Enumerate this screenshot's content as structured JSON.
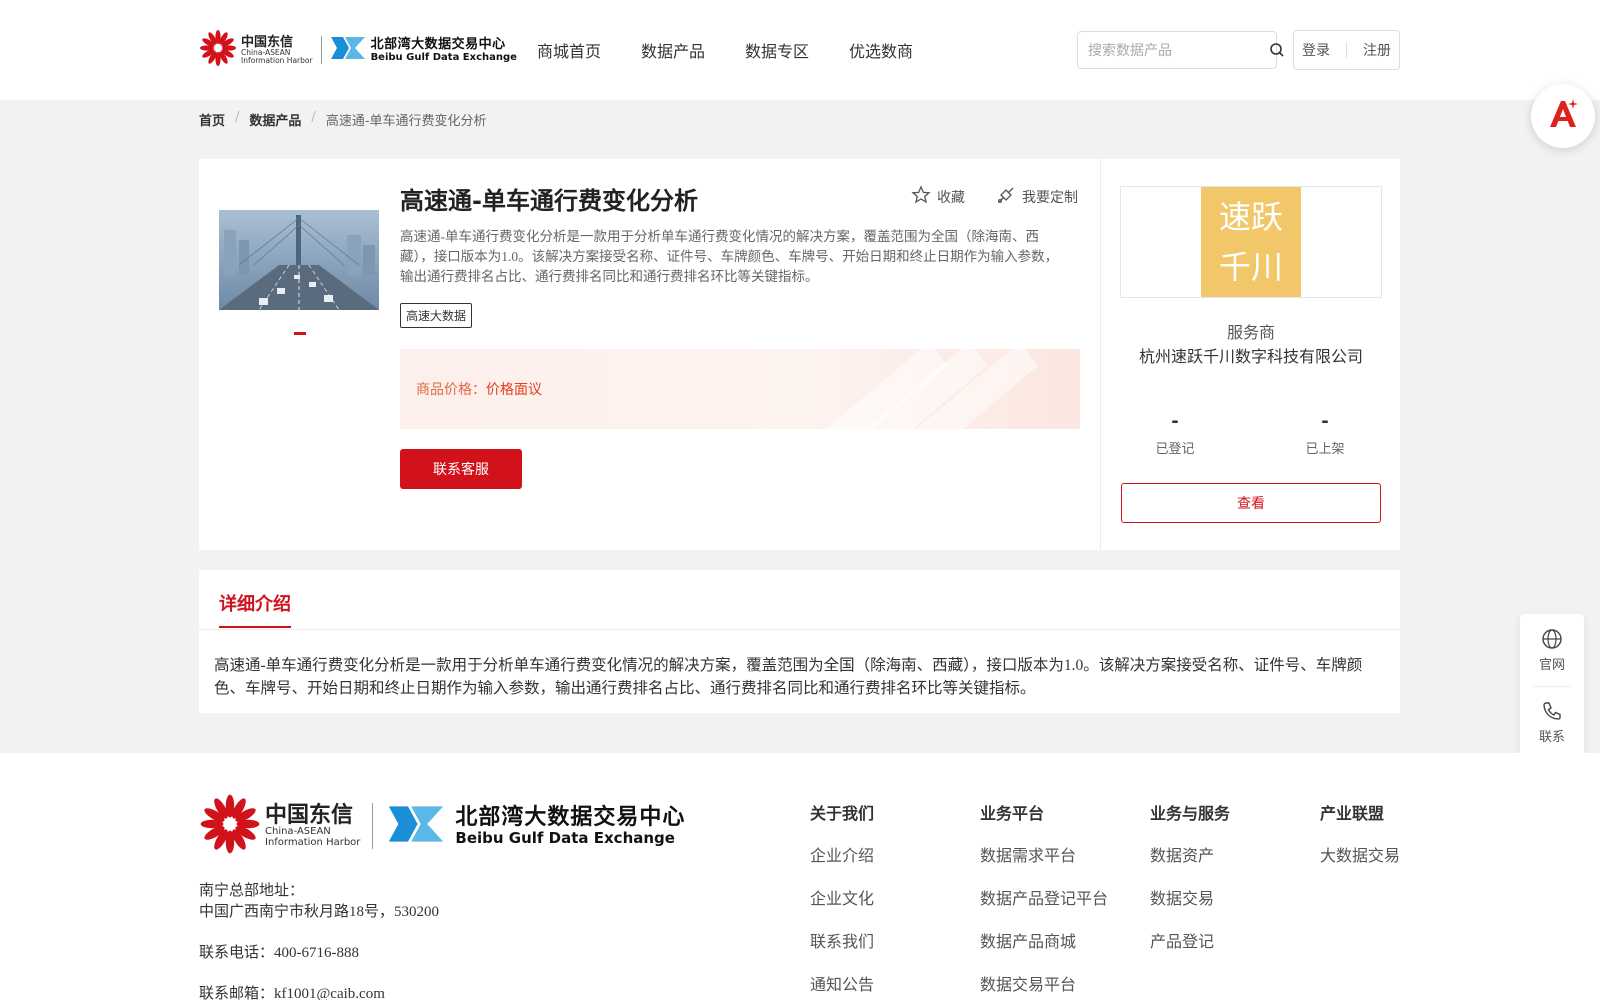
{
  "header": {
    "logo_ca_cn": "中国东信",
    "logo_ca_en1": "China-ASEAN",
    "logo_ca_en2": "Information Harbor",
    "logo_bb_cn": "北部湾大数据交易中心",
    "logo_bb_en": "Beibu Gulf Data Exchange",
    "nav": [
      "商城首页",
      "数据产品",
      "数据专区",
      "优选数商"
    ],
    "search_placeholder": "搜索数据产品",
    "login": "登录",
    "register": "注册"
  },
  "breadcrumb": [
    "首页",
    "数据产品",
    "高速通-单车通行费变化分析"
  ],
  "product": {
    "title": "高速通-单车通行费变化分析",
    "favorite": "收藏",
    "customize": "我要定制",
    "description": "高速通-单车通行费变化分析是一款用于分析单车通行费变化情况的解决方案，覆盖范围为全国（除海南、西藏），接口版本为1.0。该解决方案接受名称、证件号、车牌颜色、车牌号、开始日期和终止日期作为输入参数，输出通行费排名占比、通行费排名同比和通行费排名环比等关键指标。",
    "tag": "高速大数据",
    "price_label": "商品价格：",
    "price_value": "价格面议",
    "contact_button": "联系客服"
  },
  "provider": {
    "logo_line1": "速跃",
    "logo_line2": "千川",
    "label": "服务商",
    "name": "杭州速跃千川数字科技有限公司",
    "registered_value": "-",
    "registered_label": "已登记",
    "listed_value": "-",
    "listed_label": "已上架",
    "view_button": "查看"
  },
  "detail": {
    "tab": "详细介绍",
    "text": "高速通-单车通行费变化分析是一款用于分析单车通行费变化情况的解决方案，覆盖范围为全国（除海南、西藏），接口版本为1.0。该解决方案接受名称、证件号、车牌颜色、车牌号、开始日期和终止日期作为输入参数，输出通行费排名占比、通行费排名同比和通行费排名环比等关键指标。"
  },
  "side_float": {
    "official_site": "官网",
    "contact": "联系"
  },
  "footer": {
    "address_label": "南宁总部地址：",
    "address": "中国广西南宁市秋月路18号，530200",
    "phone": "联系电话：400-6716-888",
    "email": "联系邮箱：kf1001@caib.com",
    "columns": [
      {
        "head": "关于我们",
        "items": [
          "企业介绍",
          "企业文化",
          "联系我们",
          "通知公告"
        ]
      },
      {
        "head": "业务平台",
        "items": [
          "数据需求平台",
          "数据产品登记平台",
          "数据产品商城",
          "数据交易平台"
        ]
      },
      {
        "head": "业务与服务",
        "items": [
          "数据资产",
          "数据交易",
          "产品登记"
        ]
      },
      {
        "head": "产业联盟",
        "items": [
          "大数据交易"
        ]
      }
    ]
  },
  "colors": {
    "brand_red": "#d1121b",
    "page_gray": "#f2f2f4",
    "provider_logo_bg": "#f2c76a",
    "price_text": "#e0401a"
  },
  "icons": [
    "flower-logo-icon",
    "bbd-logo-icon",
    "search-icon",
    "star-icon",
    "customize-icon",
    "ai-assistant-icon",
    "globe-icon",
    "phone-icon"
  ]
}
